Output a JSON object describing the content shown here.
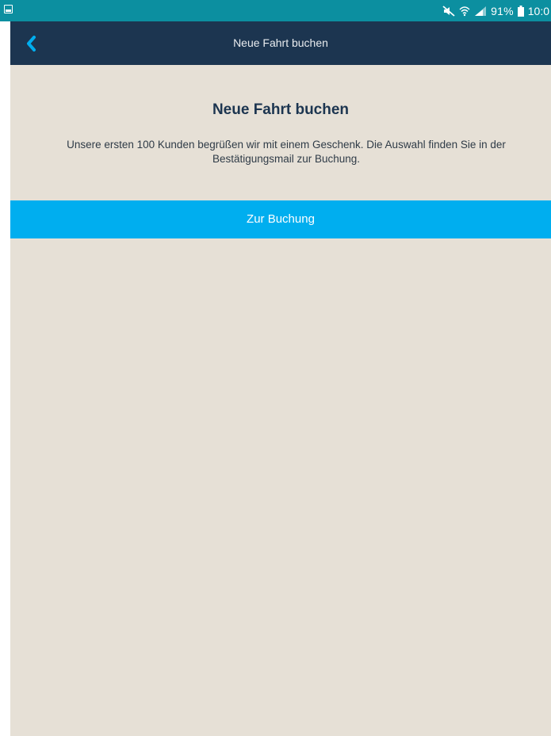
{
  "status_bar": {
    "battery_percent": "91%",
    "time": "10:0",
    "icons": [
      "gallery-icon",
      "mute-icon",
      "wifi-icon",
      "signal-icon",
      "battery-icon"
    ]
  },
  "nav_bar": {
    "back_icon": "chevron-left-icon",
    "title": "Neue Fahrt buchen"
  },
  "main": {
    "heading": "Neue Fahrt buchen",
    "description": "Unsere ersten 100 Kunden begrüßen wir mit einem Geschenk. Die Auswahl finden Sie in der Bestätigungsmail zur Buchung.",
    "booking_button_label": "Zur Buchung"
  },
  "colors": {
    "status_bar": "#0c8fa0",
    "nav_bar": "#1c3550",
    "accent": "#00aeef",
    "background": "#e6e0d6",
    "heading": "#1c3550"
  }
}
